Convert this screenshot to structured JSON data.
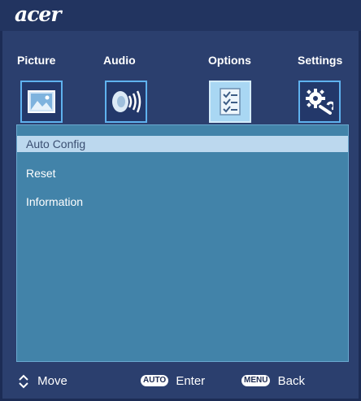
{
  "header": {
    "logo": "acer"
  },
  "tabs": [
    {
      "label": "Picture",
      "icon": "picture-icon"
    },
    {
      "label": "Audio",
      "icon": "speaker-icon"
    },
    {
      "label": "Options",
      "icon": "checklist-icon",
      "active": true
    },
    {
      "label": "Settings",
      "icon": "gear-wrench-icon"
    }
  ],
  "menu": {
    "items": [
      {
        "label": "Auto Config",
        "selected": true
      },
      {
        "label": "Reset"
      },
      {
        "label": "Information"
      }
    ]
  },
  "footer": {
    "move_label": "Move",
    "auto_key": "AUTO",
    "enter_label": "Enter",
    "menu_key": "MENU",
    "back_label": "Back"
  },
  "colors": {
    "background": "#2b3f6e",
    "panel": "#4283a9",
    "highlight": "#bcd8ee",
    "tab_border": "#5fb2ef",
    "active_tab": "#a9d7f3"
  }
}
